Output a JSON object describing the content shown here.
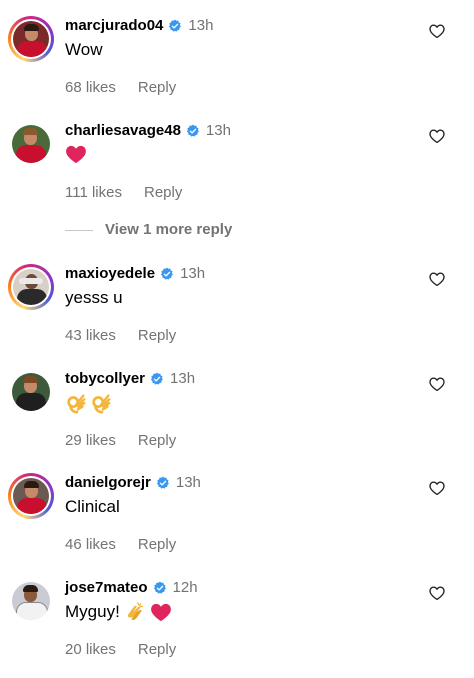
{
  "comments": [
    {
      "username": "marcjurado04",
      "time": "13h",
      "text": "Wow",
      "likes": "68 likes",
      "reply": "Reply",
      "emojis": []
    },
    {
      "username": "charliesavage48",
      "time": "13h",
      "text": "",
      "likes": "111 likes",
      "reply": "Reply",
      "emojis": [
        "red-heart"
      ]
    },
    {
      "username": "maxioyedele",
      "time": "13h",
      "text": "yesss u",
      "likes": "43 likes",
      "reply": "Reply",
      "emojis": []
    },
    {
      "username": "tobycollyer",
      "time": "13h",
      "text": "",
      "likes": "29 likes",
      "reply": "Reply",
      "emojis": [
        "ok-hand",
        "ok-hand"
      ]
    },
    {
      "username": "danielgorejr",
      "time": "13h",
      "text": "Clinical",
      "likes": "46 likes",
      "reply": "Reply",
      "emojis": []
    },
    {
      "username": "jose7mateo",
      "time": "12h",
      "text": "Myguy!",
      "likes": "20 likes",
      "reply": "Reply",
      "emojis": [
        "clapping-hands",
        "red-heart"
      ]
    }
  ],
  "view_more_replies": "View 1 more reply",
  "colors": {
    "verified": "#3897f0",
    "muted": "#737373",
    "heart_emoji": "#e0245e"
  }
}
